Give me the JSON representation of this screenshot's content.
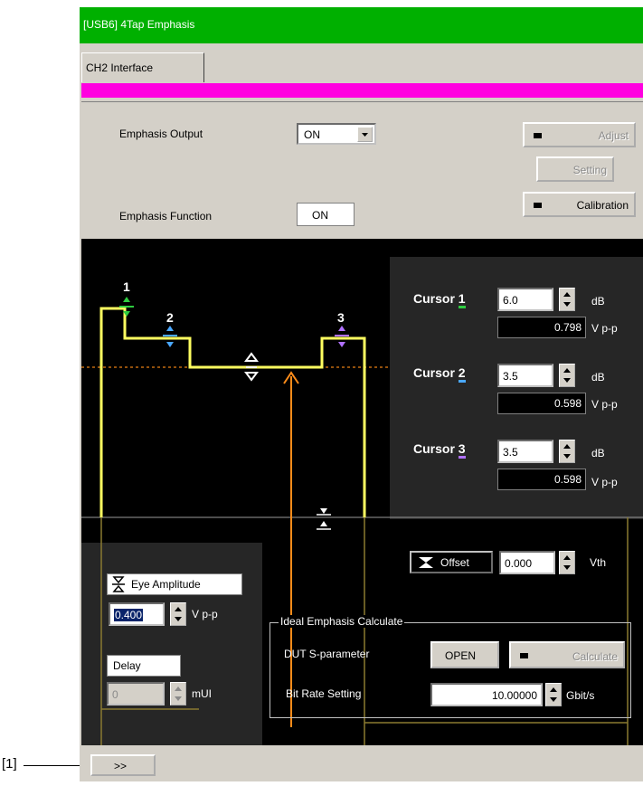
{
  "callout": "[1]",
  "window": {
    "title": "[USB6] 4Tap Emphasis"
  },
  "tabs": [
    {
      "label": "CH2 Interface"
    }
  ],
  "controls": {
    "emphasis_output_label": "Emphasis Output",
    "emphasis_output_value": "ON",
    "emphasis_function_label": "Emphasis Function",
    "emphasis_function_value": "ON",
    "adjust_label": "Adjust",
    "setting_label": "Setting",
    "calibration_label": "Calibration"
  },
  "graph": {
    "markers": [
      "1",
      "2",
      "3"
    ]
  },
  "cursors": [
    {
      "label": "Cursor",
      "num": "1",
      "db": "6.0",
      "vpp": "0.798",
      "color": "#2ecc40"
    },
    {
      "label": "Cursor",
      "num": "2",
      "db": "3.5",
      "vpp": "0.598",
      "color": "#4aa8ff"
    },
    {
      "label": "Cursor",
      "num": "3",
      "db": "3.5",
      "vpp": "0.598",
      "color": "#b070ff"
    }
  ],
  "units": {
    "db": "dB",
    "vpp": "V p-p",
    "vth": "Vth",
    "mui": "mUI",
    "gbits": "Gbit/s"
  },
  "offset": {
    "label": "Offset",
    "value": "0.000"
  },
  "eye": {
    "label": "Eye Amplitude",
    "value": "0.400"
  },
  "delay": {
    "label": "Delay",
    "value": "0"
  },
  "ideal": {
    "group_label": "Ideal Emphasis Calculate",
    "dut_label": "DUT S-parameter",
    "open_label": "OPEN",
    "calculate_label": "Calculate",
    "bitrate_label": "Bit Rate Setting",
    "bitrate_value": "10.00000"
  },
  "bottom": {
    "expand_label": ">>"
  }
}
